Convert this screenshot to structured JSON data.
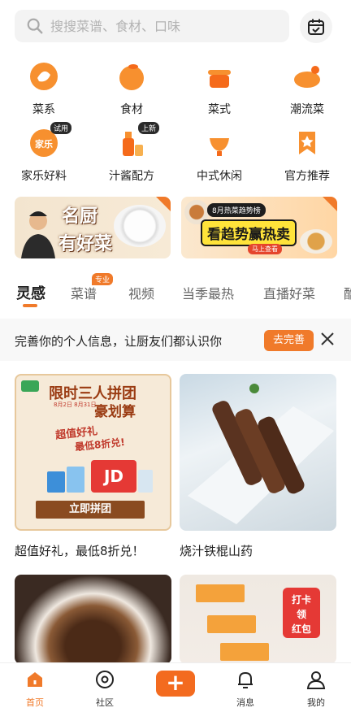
{
  "search": {
    "placeholder": "搜搜菜谱、食材、口味"
  },
  "categories": [
    {
      "label": "菜系",
      "icon": "shrimp-icon",
      "tag": ""
    },
    {
      "label": "食材",
      "icon": "orange-icon",
      "tag": ""
    },
    {
      "label": "菜式",
      "icon": "pot-icon",
      "tag": ""
    },
    {
      "label": "潮流菜",
      "icon": "roast-chicken-icon",
      "tag": ""
    },
    {
      "label": "家乐好料",
      "icon": "knorr-logo-icon",
      "tag": "试用"
    },
    {
      "label": "汁酱配方",
      "icon": "sauce-bottle-icon",
      "tag": "上新"
    },
    {
      "label": "中式休闲",
      "icon": "teapot-icon",
      "tag": ""
    },
    {
      "label": "官方推荐",
      "icon": "bookmark-star-icon",
      "tag": ""
    }
  ],
  "banners": {
    "left": {
      "line1": "名厨",
      "line2": "有好菜"
    },
    "right": {
      "pill": "8月热菜趋势榜",
      "main": "看趋势赢热卖",
      "cta": "马上查看"
    }
  },
  "tabs": [
    "灵感",
    "菜谱",
    "视频",
    "当季最热",
    "直播好菜",
    "酷"
  ],
  "tab_badge": "专业",
  "notice": {
    "text": "完善你的个人信息，让厨友们都认识你",
    "button": "去完善"
  },
  "promo": {
    "head": "限时三人拼团",
    "head2": "豪划算",
    "dates": "8月2日 8月31日",
    "sub": "超值好礼",
    "sub2": "最低8折兑!",
    "gift": "JD",
    "cta": "立即拼团"
  },
  "cards": [
    {
      "title": "超值好礼，最低8折兑！"
    },
    {
      "title": "烧汁铁棍山药"
    }
  ],
  "card4_badge": {
    "line1": "打卡",
    "line2": "领",
    "line3": "红包"
  },
  "nav": [
    {
      "label": "首页"
    },
    {
      "label": "社区"
    },
    {
      "label": "+"
    },
    {
      "label": "消息"
    },
    {
      "label": "我的"
    }
  ],
  "colors": {
    "accent": "#f07a2a",
    "text": "#222222",
    "muted": "#b3b3b3"
  }
}
